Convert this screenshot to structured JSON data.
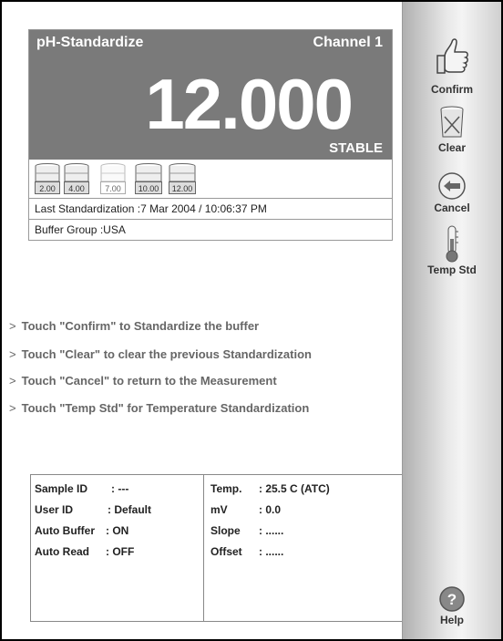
{
  "header": {
    "title": "pH-Standardize",
    "channel": "Channel 1",
    "reading": "12.000",
    "status": "STABLE"
  },
  "buffers": [
    {
      "label": "2.00",
      "standardized": true
    },
    {
      "label": "4.00",
      "standardized": true
    },
    {
      "label": "7.00",
      "standardized": false
    },
    {
      "label": "10.00",
      "standardized": true
    },
    {
      "label": "12.00",
      "standardized": true
    }
  ],
  "last_standardization": "Last Standardization :7 Mar 2004 / 10:06:37 PM",
  "buffer_group": "Buffer Group :USA",
  "instructions": [
    "Touch \"Confirm\" to Standardize the buffer",
    "Touch \"Clear\" to clear the previous Standardization",
    "Touch \"Cancel\" to return to the Measurement",
    "Touch \"Temp Std\" for Temperature  Standardization"
  ],
  "instruction_marker": ">",
  "info_left": [
    {
      "key": "Sample ID",
      "value": ":  ---"
    },
    {
      "key": "User ID",
      "value": ": Default"
    },
    {
      "key": "Auto Buffer",
      "value": ": ON"
    },
    {
      "key": "Auto Read",
      "value": ": OFF"
    }
  ],
  "info_right": [
    {
      "key": "Temp.",
      "value": ": 25.5 C (ATC)"
    },
    {
      "key": "mV",
      "value": ": 0.0"
    },
    {
      "key": "Slope",
      "value": ": ......"
    },
    {
      "key": "Offset",
      "value": ": ......"
    }
  ],
  "sidebar": {
    "confirm": "Confirm",
    "clear": "Clear",
    "cancel": "Cancel",
    "temp_std": "Temp Std",
    "help": "Help"
  }
}
